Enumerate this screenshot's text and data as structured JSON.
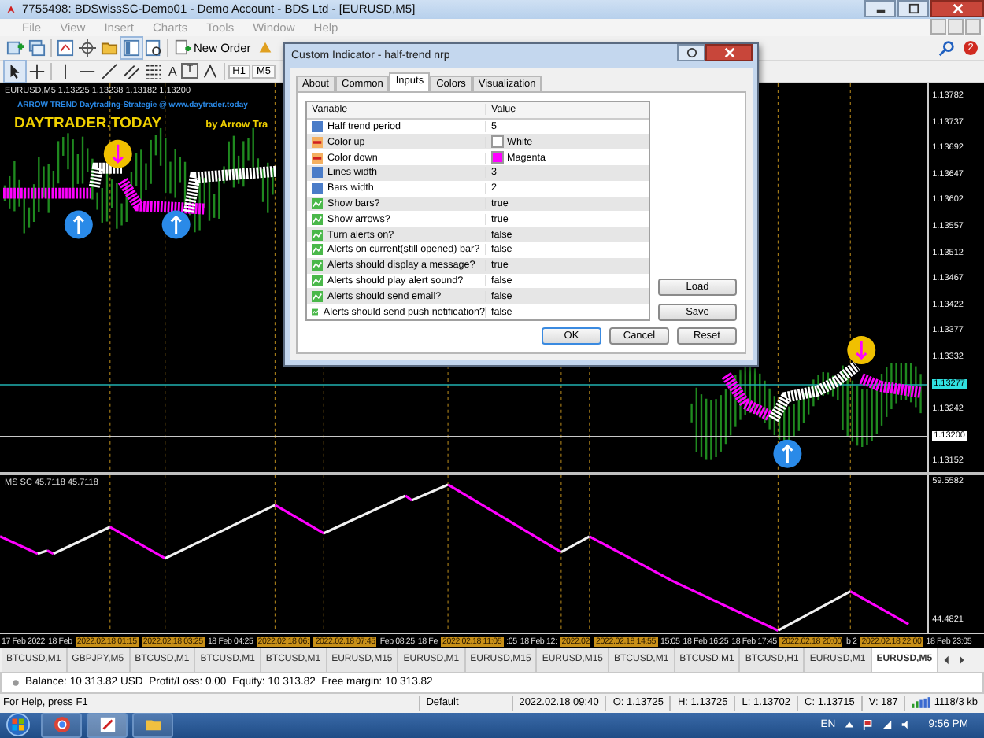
{
  "window": {
    "title": "7755498: BDSwissSC-Demo01 - Demo Account - BDS Ltd - [EURUSD,M5]"
  },
  "menu": [
    "File",
    "View",
    "Insert",
    "Charts",
    "Tools",
    "Window",
    "Help"
  ],
  "toolbar": {
    "new_order": "New Order",
    "text_tools": [
      "A",
      "T"
    ],
    "periods": [
      "H1",
      "M5"
    ],
    "notification_count": "2"
  },
  "chart": {
    "info": "EURUSD,M5  1.13225 1.13238 1.13182 1.13200",
    "banner": "ARROW TREND Daytrading-Strategie @ www.daytrader.today",
    "logo": "DAYTRADER.TODAY",
    "byline": "by Arrow Tra",
    "price_labels": [
      {
        "text": "1.13782",
        "kind": "scale"
      },
      {
        "text": "1.13737",
        "kind": "scale"
      },
      {
        "text": "1.13692",
        "kind": "scale"
      },
      {
        "text": "1.13647",
        "kind": "scale"
      },
      {
        "text": "1.13602",
        "kind": "scale"
      },
      {
        "text": "1.13557",
        "kind": "scale"
      },
      {
        "text": "1.13512",
        "kind": "scale"
      },
      {
        "text": "1.13467",
        "kind": "scale"
      },
      {
        "text": "1.13422",
        "kind": "scale"
      },
      {
        "text": "1.13377",
        "kind": "scale"
      },
      {
        "text": "1.13332",
        "kind": "scale"
      },
      {
        "text": "1.13277",
        "kind": "bid"
      },
      {
        "text": "1.13242",
        "kind": "scale"
      },
      {
        "text": "1.13200",
        "kind": "line"
      },
      {
        "text": "1.13152",
        "kind": "scale"
      }
    ]
  },
  "indicator": {
    "label": "MS SC  45.7118 45.7118",
    "scale_max": "59.5582",
    "scale_min": "44.4821"
  },
  "time_axis": [
    {
      "text": "17 Feb 2022",
      "kind": "time"
    },
    {
      "text": "18 Feb",
      "kind": "time"
    },
    {
      "text": "2022.02.18 01:15",
      "kind": "marker"
    },
    {
      "text": "2022.02.18 03:25",
      "kind": "marker"
    },
    {
      "text": "18 Feb 04:25",
      "kind": "time"
    },
    {
      "text": "2022.02.18 06:",
      "kind": "marker"
    },
    {
      "text": "2022.02.18 07:45",
      "kind": "marker"
    },
    {
      "text": "Feb 08:25",
      "kind": "time"
    },
    {
      "text": "18 Fe",
      "kind": "time"
    },
    {
      "text": "2022.02.18 11:05",
      "kind": "marker"
    },
    {
      "text": ":05",
      "kind": "time"
    },
    {
      "text": "18 Feb 12:",
      "kind": "time"
    },
    {
      "text": "2022.02",
      "kind": "marker"
    },
    {
      "text": "2022.02.18 14:55",
      "kind": "marker"
    },
    {
      "text": "15:05",
      "kind": "time"
    },
    {
      "text": "18 Feb 16:25",
      "kind": "time"
    },
    {
      "text": "18 Feb 17:45",
      "kind": "time"
    },
    {
      "text": "2022.02.18 20:00",
      "kind": "marker"
    },
    {
      "text": "b 2",
      "kind": "time"
    },
    {
      "text": "2022.02.18 22:00",
      "kind": "marker"
    },
    {
      "text": "18 Feb 23:05",
      "kind": "time"
    }
  ],
  "chart_tabs": [
    {
      "label": "BTCUSD,M1",
      "selected": false
    },
    {
      "label": "GBPJPY,M5",
      "selected": false
    },
    {
      "label": "BTCUSD,M1",
      "selected": false
    },
    {
      "label": "BTCUSD,M1",
      "selected": false
    },
    {
      "label": "BTCUSD,M1",
      "selected": false
    },
    {
      "label": "EURUSD,M15",
      "selected": false
    },
    {
      "label": "EURUSD,M1",
      "selected": false
    },
    {
      "label": "EURUSD,M15",
      "selected": false
    },
    {
      "label": "EURUSD,M15",
      "selected": false
    },
    {
      "label": "BTCUSD,M1",
      "selected": false
    },
    {
      "label": "BTCUSD,M1",
      "selected": false
    },
    {
      "label": "BTCUSD,H1",
      "selected": false
    },
    {
      "label": "EURUSD,M1",
      "selected": false
    },
    {
      "label": "EURUSD,M5",
      "selected": true
    }
  ],
  "account": "Balance: 10 313.82 USD  Profit/Loss: 0.00  Equity: 10 313.82  Free margin: 10 313.82",
  "status_bar": {
    "help": "For Help, press F1",
    "fields": [
      "Default",
      "2022.02.18 09:40",
      "O: 1.13725",
      "H: 1.13725",
      "L: 1.13702",
      "C: 1.13715",
      "V: 187"
    ],
    "traffic": "1118/3 kb"
  },
  "taskbar": {
    "language": "EN",
    "clock": "9:56 PM"
  },
  "dialog": {
    "title": "Custom Indicator - half-trend nrp",
    "tabs": [
      {
        "label": "About",
        "selected": false
      },
      {
        "label": "Common",
        "selected": false
      },
      {
        "label": "Inputs",
        "selected": true
      },
      {
        "label": "Colors",
        "selected": false
      },
      {
        "label": "Visualization",
        "selected": false
      }
    ],
    "columns": [
      "Variable",
      "Value"
    ],
    "inputs": [
      {
        "kind": "int",
        "name": "Half trend period",
        "value": "5"
      },
      {
        "kind": "color",
        "name": "Color up",
        "value": "White",
        "color": "#ffffff"
      },
      {
        "kind": "color",
        "name": "Color down",
        "value": "Magenta",
        "color": "#ff00ff"
      },
      {
        "kind": "int",
        "name": "Lines width",
        "value": "3"
      },
      {
        "kind": "int",
        "name": "Bars width",
        "value": "2"
      },
      {
        "kind": "bool",
        "name": "Show bars?",
        "value": "true"
      },
      {
        "kind": "bool",
        "name": "Show arrows?",
        "value": "true"
      },
      {
        "kind": "bool",
        "name": "Turn alerts on?",
        "value": "false"
      },
      {
        "kind": "bool",
        "name": "Alerts on current(still opened) bar?",
        "value": "false"
      },
      {
        "kind": "bool",
        "name": "Alerts should display a message?",
        "value": "true"
      },
      {
        "kind": "bool",
        "name": "Alerts should play alert sound?",
        "value": "false"
      },
      {
        "kind": "bool",
        "name": "Alerts should send email?",
        "value": "false"
      },
      {
        "kind": "bool",
        "name": "Alerts should send push notification?",
        "value": "false"
      }
    ],
    "side_buttons": [
      "Load",
      "Save"
    ],
    "buttons": [
      {
        "label": "OK",
        "default": true
      },
      {
        "label": "Cancel",
        "default": false
      },
      {
        "label": "Reset",
        "default": false
      }
    ]
  }
}
